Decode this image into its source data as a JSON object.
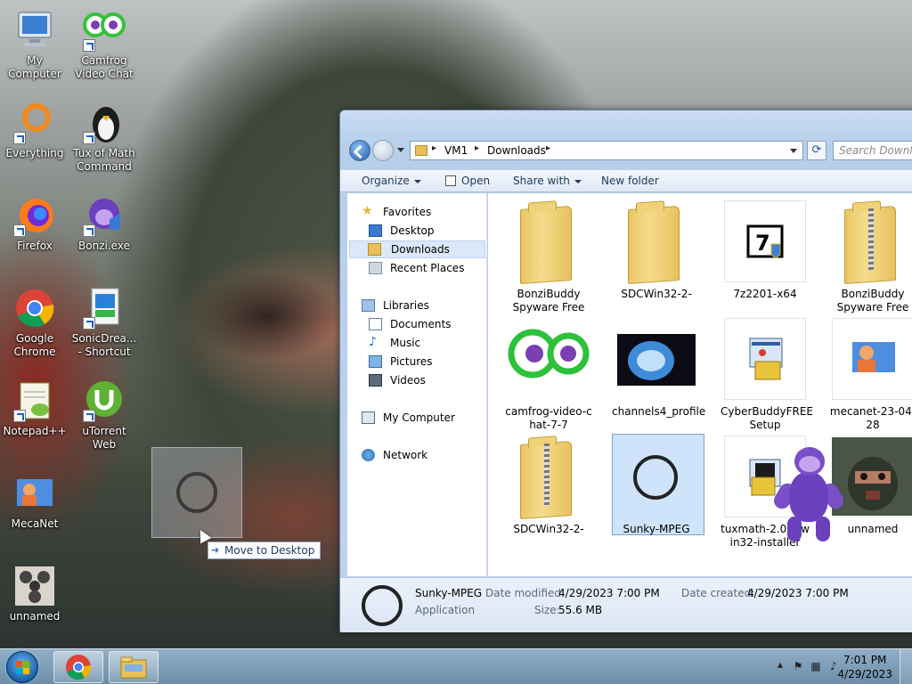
{
  "desktop": {
    "icons": [
      {
        "label": "My Computer"
      },
      {
        "label": "Camfrog Video Chat"
      },
      {
        "label": "Everything"
      },
      {
        "label": "Tux of Math Command"
      },
      {
        "label": "Firefox"
      },
      {
        "label": "Bonzi.exe"
      },
      {
        "label": "Google Chrome"
      },
      {
        "label": "SonicDrea... - Shortcut"
      },
      {
        "label": "Notepad++"
      },
      {
        "label": "uTorrent Web"
      },
      {
        "label": "MecaNet"
      },
      {
        "label": "unnamed"
      }
    ],
    "drag_tooltip": "Move to Desktop"
  },
  "explorer": {
    "breadcrumb": [
      "VM1",
      "Downloads"
    ],
    "search_placeholder": "Search Downloads",
    "toolbar": {
      "organize": "Organize",
      "open": "Open",
      "share_with": "Share with",
      "new_folder": "New folder"
    },
    "nav": {
      "favorites": "Favorites",
      "desktop": "Desktop",
      "downloads": "Downloads",
      "recent_places": "Recent Places",
      "libraries": "Libraries",
      "documents": "Documents",
      "music": "Music",
      "pictures": "Pictures",
      "videos": "Videos",
      "my_computer": "My Computer",
      "network": "Network"
    },
    "files": [
      {
        "name": "BonziBuddy Spyware Free",
        "kind": "folder"
      },
      {
        "name": "SDCWin32-2-",
        "kind": "folder"
      },
      {
        "name": "7z2201-x64",
        "kind": "installer"
      },
      {
        "name": "BonziBuddy Spyware Free",
        "kind": "zip-folder"
      },
      {
        "name": "camfrog-video-chat-7-7",
        "kind": "camfrog"
      },
      {
        "name": "channels4_profile",
        "kind": "image"
      },
      {
        "name": "CyberBuddyFREE Setup",
        "kind": "installer"
      },
      {
        "name": "mecanet-23-04-28",
        "kind": "mecanet"
      },
      {
        "name": "SDCWin32-2-",
        "kind": "zip-folder"
      },
      {
        "name": "Sunky-MPEG",
        "kind": "app"
      },
      {
        "name": "tuxmath-2.0.2-win32-installer",
        "kind": "installer"
      },
      {
        "name": "unnamed",
        "kind": "image"
      }
    ],
    "details": {
      "name": "Sunky-MPEG",
      "type": "Application",
      "date_modified_label": "Date modified:",
      "date_modified": "4/29/2023 7:00 PM",
      "date_created_label": "Date created:",
      "date_created": "4/29/2023 7:00 PM",
      "size_label": "Size:",
      "size": "55.6 MB"
    }
  },
  "taskbar": {
    "time": "7:01 PM",
    "date": "4/29/2023"
  },
  "colors": {
    "accent": "#1e5ba8",
    "selection": "#cfe3fb"
  }
}
